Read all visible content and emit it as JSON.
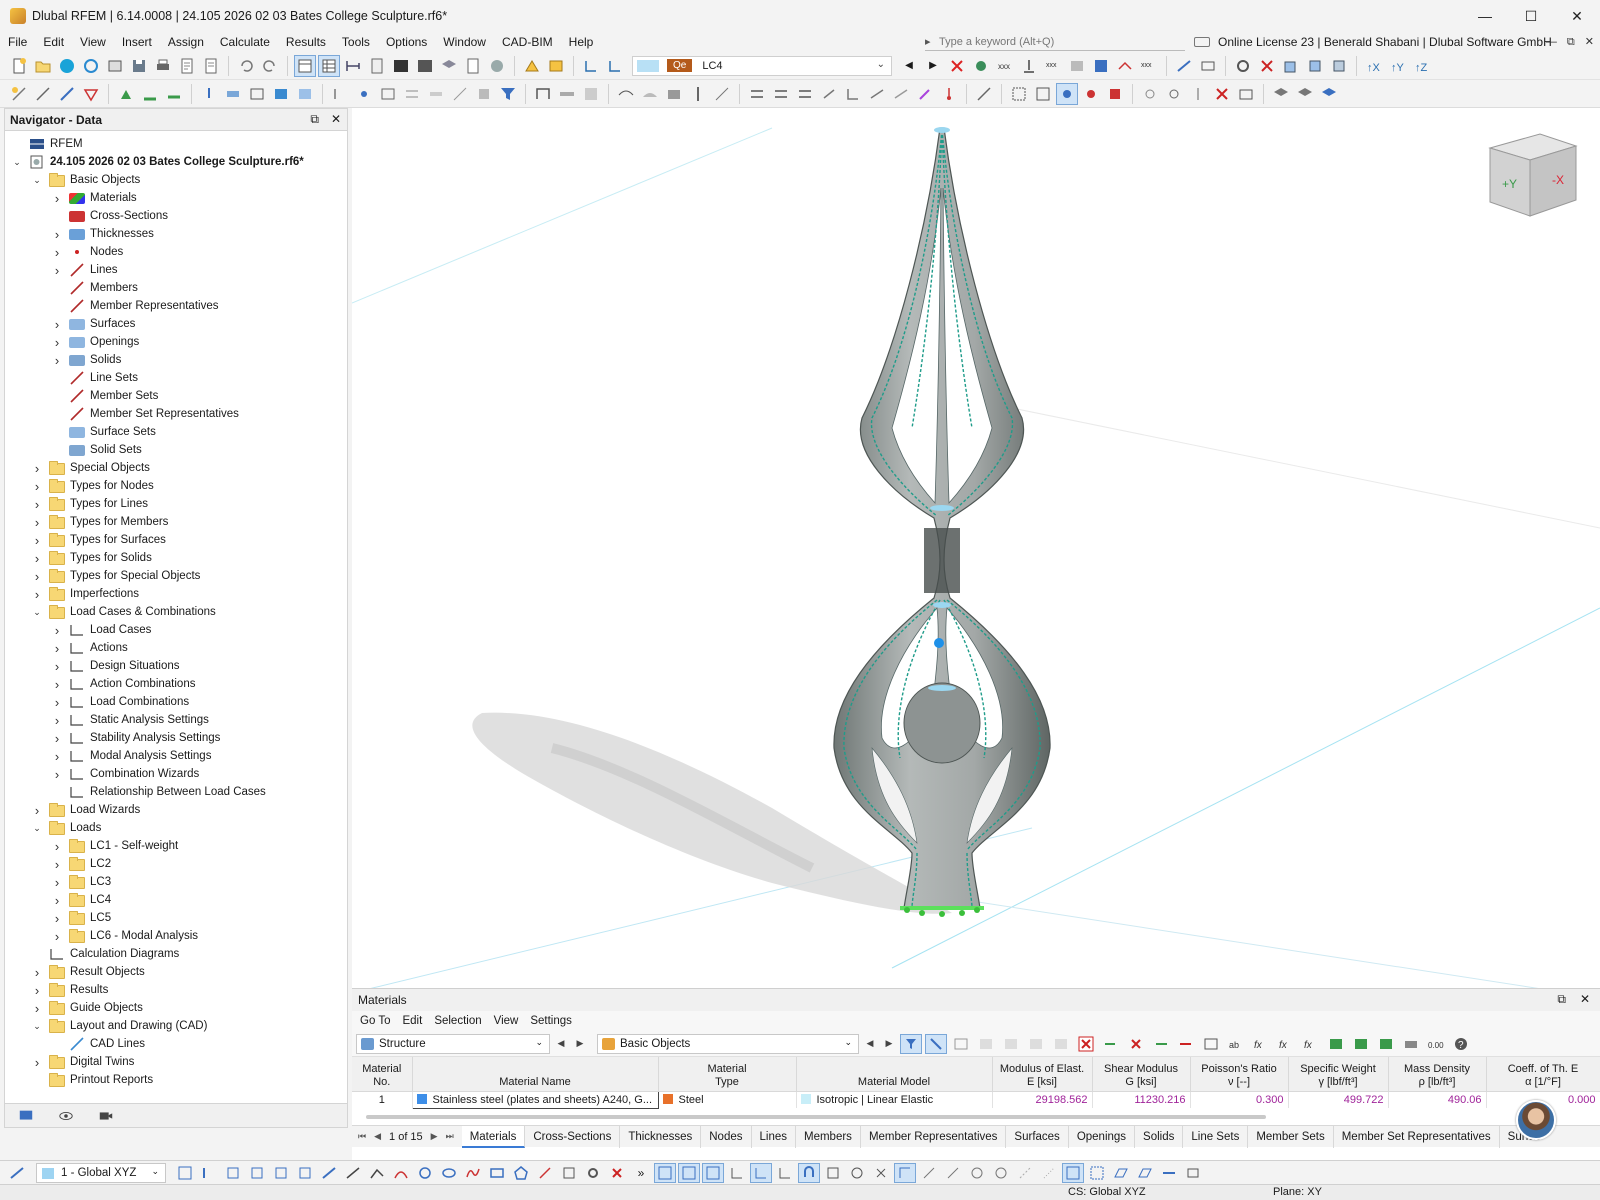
{
  "window": {
    "title": "Dlubal RFEM | 6.14.0008 | 24.105 2026 02 03 Bates College Sculpture.rf6*",
    "minimize": "—",
    "maximize": "☐",
    "close": "✕"
  },
  "menu": {
    "items": [
      "File",
      "Edit",
      "View",
      "Insert",
      "Assign",
      "Calculate",
      "Results",
      "Tools",
      "Options",
      "Window",
      "CAD-BIM",
      "Help"
    ],
    "search_placeholder": "Type a keyword (Alt+Q)",
    "license": "Online License 23 | Benerald Shabani | Dlubal Software GmbH"
  },
  "toolbar": {
    "load_case_tag": "Qe",
    "load_case": "LC4"
  },
  "navigator": {
    "title": "Navigator - Data",
    "root": "RFEM",
    "file": "24.105 2026 02 03 Bates College Sculpture.rf6*",
    "basic_objects": "Basic Objects",
    "basic_items": [
      "Materials",
      "Cross-Sections",
      "Thicknesses",
      "Nodes",
      "Lines",
      "Members",
      "Member Representatives",
      "Surfaces",
      "Openings",
      "Solids",
      "Line Sets",
      "Member Sets",
      "Member Set Representatives",
      "Surface Sets",
      "Solid Sets"
    ],
    "groups_a": [
      "Special Objects",
      "Types for Nodes",
      "Types for Lines",
      "Types for Members",
      "Types for Surfaces",
      "Types for Solids",
      "Types for Special Objects",
      "Imperfections"
    ],
    "load_cases_combinations": "Load Cases & Combinations",
    "lcc_items": [
      "Load Cases",
      "Actions",
      "Design Situations",
      "Action Combinations",
      "Load Combinations",
      "Static Analysis Settings",
      "Stability Analysis Settings",
      "Modal Analysis Settings",
      "Combination Wizards",
      "Relationship Between Load Cases"
    ],
    "load_wizards": "Load Wizards",
    "loads": "Loads",
    "load_items": [
      "LC1 - Self-weight",
      "LC2",
      "LC3",
      "LC4",
      "LC5",
      "LC6 - Modal Analysis"
    ],
    "calculation_diagrams": "Calculation Diagrams",
    "result_objects": "Result Objects",
    "results": "Results",
    "guide_objects": "Guide Objects",
    "layout_drawing": "Layout and Drawing (CAD)",
    "cad_lines": "CAD Lines",
    "digital_twins": "Digital Twins",
    "printout_reports": "Printout Reports"
  },
  "viewcube": {
    "face_front": "+Y",
    "face_side": "-X"
  },
  "materials_panel": {
    "title": "Materials",
    "menu": [
      "Go To",
      "Edit",
      "Selection",
      "View",
      "Settings"
    ],
    "structure_combo": "Structure",
    "objects_combo": "Basic Objects",
    "columns": [
      {
        "l1": "Material",
        "l2": "No."
      },
      {
        "l1": "",
        "l2": "Material Name"
      },
      {
        "l1": "Material",
        "l2": "Type"
      },
      {
        "l1": "",
        "l2": "Material Model"
      },
      {
        "l1": "Modulus of Elast.",
        "l2": "E [ksi]"
      },
      {
        "l1": "Shear Modulus",
        "l2": "G [ksi]"
      },
      {
        "l1": "Poisson's Ratio",
        "l2": "ν [--]"
      },
      {
        "l1": "Specific Weight",
        "l2": "γ [lbf/ft³]"
      },
      {
        "l1": "Mass Density",
        "l2": "ρ [lb/ft³]"
      },
      {
        "l1": "Coeff. of Th. E",
        "l2": "α [1/°F]"
      }
    ],
    "row": {
      "no": "1",
      "name": "Stainless steel (plates and sheets) A240, G...",
      "type": "Steel",
      "model": "Isotropic | Linear Elastic",
      "e": "29198.562",
      "g": "11230.216",
      "nu": "0.300",
      "gamma": "499.722",
      "rho": "490.06",
      "alpha": "0.000"
    },
    "colors": {
      "name_swatch": "#3d8ee8",
      "type_swatch": "#e8712a",
      "model_swatch": "#c8eef8"
    },
    "pager": "1 of 15",
    "tabs": [
      "Materials",
      "Cross-Sections",
      "Thicknesses",
      "Nodes",
      "Lines",
      "Members",
      "Member Representatives",
      "Surfaces",
      "Openings",
      "Solids",
      "Line Sets",
      "Member Sets",
      "Member Set Representatives",
      "Surfac"
    ]
  },
  "bottom": {
    "coord_system": "1 - Global XYZ",
    "status_cs": "CS: Global XYZ",
    "status_plane": "Plane: XY"
  }
}
